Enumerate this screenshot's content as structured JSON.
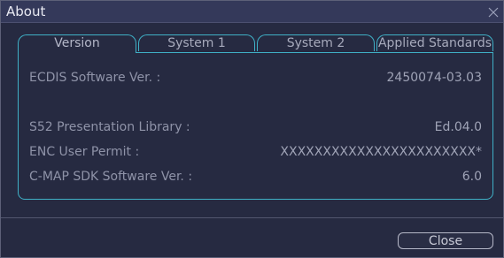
{
  "window": {
    "title": "About",
    "close_icon": "close-icon"
  },
  "tabs": [
    {
      "label": "Version",
      "active": true
    },
    {
      "label": "System 1",
      "active": false
    },
    {
      "label": "System 2",
      "active": false
    },
    {
      "label": "Applied Standards",
      "active": false
    }
  ],
  "version_info": [
    {
      "label": "ECDIS Software Ver. :",
      "value": "2450074-03.03"
    },
    {
      "label": "S52 Presentation Library :",
      "value": "Ed.04.0"
    },
    {
      "label": "ENC User Permit :",
      "value": "XXXXXXXXXXXXXXXXXXXXXXX*"
    },
    {
      "label": "C-MAP SDK Software Ver. :",
      "value": "6.0"
    }
  ],
  "footer": {
    "close_label": "Close"
  },
  "colors": {
    "accent": "#3fb0c6",
    "background": "#262a41",
    "titlebar": "#34395a"
  }
}
